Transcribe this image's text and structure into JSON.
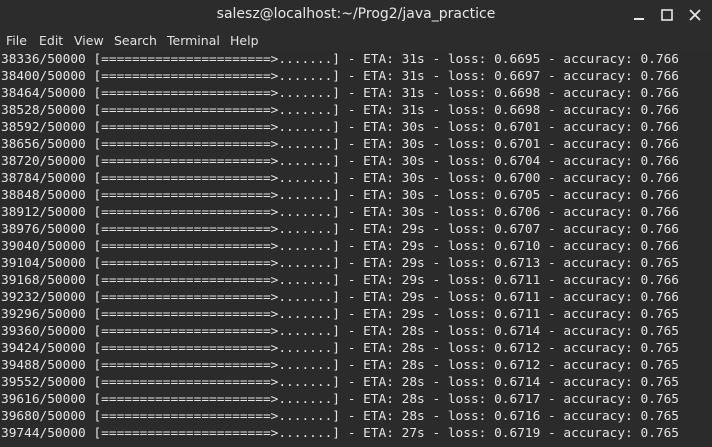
{
  "window": {
    "title": "salesz@localhost:~/Prog2/java_practice",
    "buttons": {
      "minimize_icon": "minimize-icon",
      "maximize_icon": "maximize-icon",
      "close_icon": "close-icon"
    }
  },
  "menubar": {
    "items": [
      "File",
      "Edit",
      "View",
      "Search",
      "Terminal",
      "Help"
    ]
  },
  "terminal": {
    "colors": {
      "background": "#2b2b2b",
      "foreground": "#e4e4e4"
    },
    "lines": [
      "38336/50000 [======================>.......] - ETA: 31s - loss: 0.6695 - accuracy: 0.766",
      "38400/50000 [======================>.......] - ETA: 31s - loss: 0.6697 - accuracy: 0.766",
      "38464/50000 [======================>.......] - ETA: 31s - loss: 0.6698 - accuracy: 0.766",
      "38528/50000 [======================>.......] - ETA: 31s - loss: 0.6698 - accuracy: 0.766",
      "38592/50000 [======================>.......] - ETA: 30s - loss: 0.6701 - accuracy: 0.766",
      "38656/50000 [======================>.......] - ETA: 30s - loss: 0.6701 - accuracy: 0.766",
      "38720/50000 [======================>.......] - ETA: 30s - loss: 0.6704 - accuracy: 0.766",
      "38784/50000 [======================>.......] - ETA: 30s - loss: 0.6700 - accuracy: 0.766",
      "38848/50000 [======================>.......] - ETA: 30s - loss: 0.6705 - accuracy: 0.766",
      "38912/50000 [======================>.......] - ETA: 30s - loss: 0.6706 - accuracy: 0.766",
      "38976/50000 [======================>.......] - ETA: 29s - loss: 0.6707 - accuracy: 0.766",
      "39040/50000 [======================>.......] - ETA: 29s - loss: 0.6710 - accuracy: 0.766",
      "39104/50000 [======================>.......] - ETA: 29s - loss: 0.6713 - accuracy: 0.765",
      "39168/50000 [======================>.......] - ETA: 29s - loss: 0.6711 - accuracy: 0.766",
      "39232/50000 [======================>.......] - ETA: 29s - loss: 0.6711 - accuracy: 0.766",
      "39296/50000 [======================>.......] - ETA: 29s - loss: 0.6711 - accuracy: 0.765",
      "39360/50000 [======================>.......] - ETA: 28s - loss: 0.6714 - accuracy: 0.765",
      "39424/50000 [======================>.......] - ETA: 28s - loss: 0.6712 - accuracy: 0.765",
      "39488/50000 [======================>.......] - ETA: 28s - loss: 0.6712 - accuracy: 0.765",
      "39552/50000 [======================>.......] - ETA: 28s - loss: 0.6714 - accuracy: 0.765",
      "39616/50000 [======================>.......] - ETA: 28s - loss: 0.6717 - accuracy: 0.765",
      "39680/50000 [======================>.......] - ETA: 28s - loss: 0.6716 - accuracy: 0.765",
      "39744/50000 [======================>.......] - ETA: 27s - loss: 0.6719 - accuracy: 0.765"
    ]
  }
}
